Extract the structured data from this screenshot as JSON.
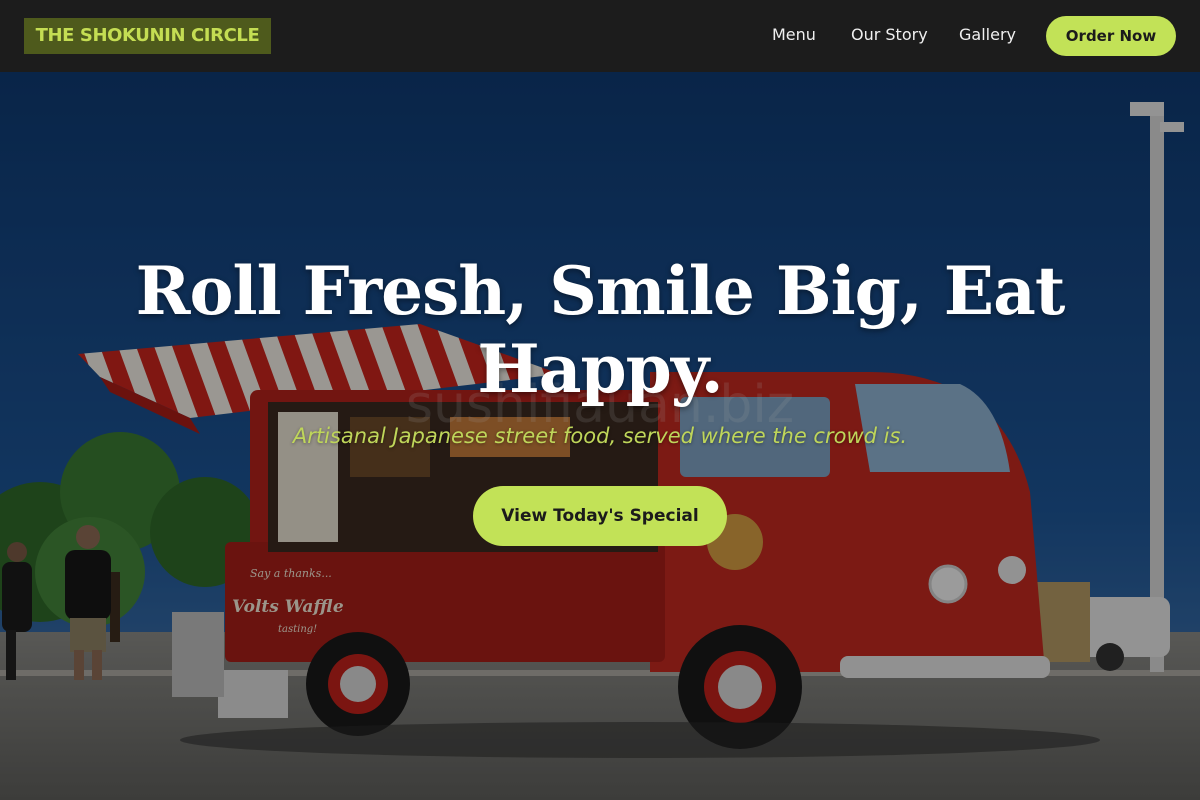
{
  "header": {
    "brand": "THE SHOKUNIN CIRCLE",
    "nav": [
      "Menu",
      "Our Story",
      "Gallery"
    ],
    "cta": "Order Now"
  },
  "hero": {
    "headline": "Roll Fresh, Smile Big, Eat Happy.",
    "tagline": "Artisanal Japanese street food, served where the crowd is.",
    "button": "View Today's Special",
    "photo": {
      "subject": "red food truck with striped awning in a parking lot",
      "watermark": "sushifiauan.biz",
      "truck_lettering": [
        "Say a thanks...",
        "Volts Waffle",
        "tasting!"
      ]
    }
  },
  "colors": {
    "accent": "#c2e257",
    "brand_bg": "#4e5a1c",
    "brand_text": "#c4dd53",
    "header_bg": "#1c1c1c",
    "tagline": "#bfd65a"
  }
}
